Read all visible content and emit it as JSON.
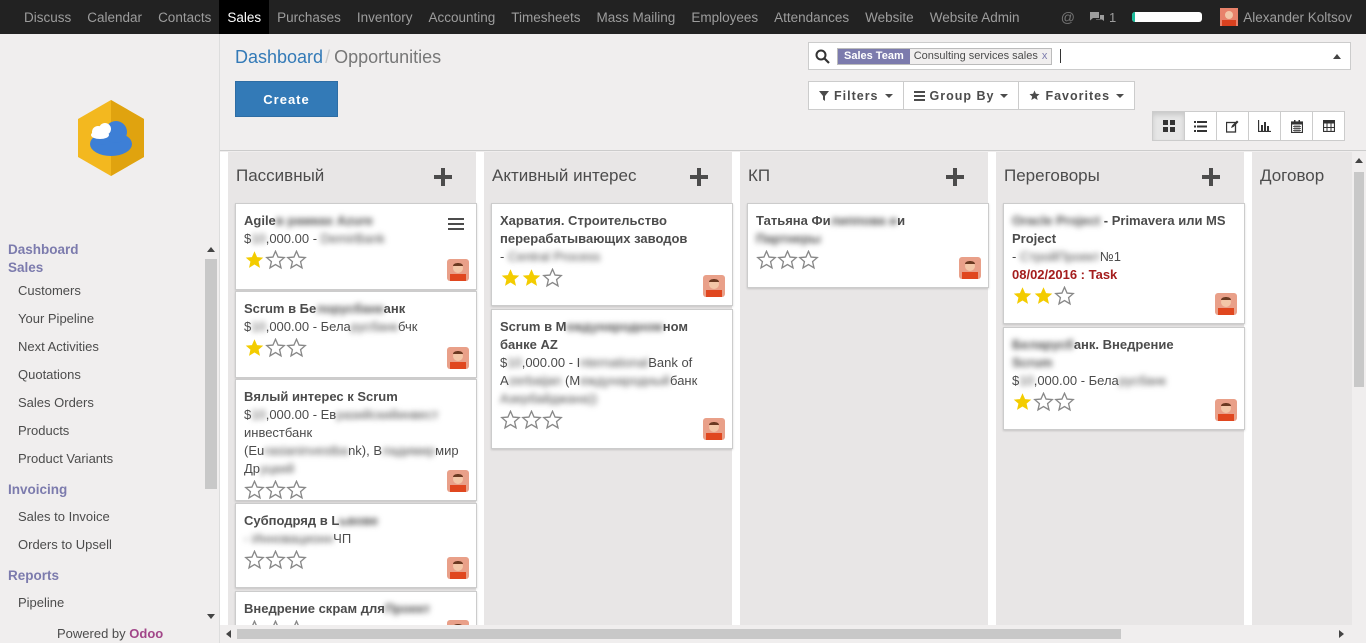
{
  "topmenu": [
    "Discuss",
    "Calendar",
    "Contacts",
    "Sales",
    "Purchases",
    "Inventory",
    "Accounting",
    "Timesheets",
    "Mass Mailing",
    "Employees",
    "Attendances",
    "Website",
    "Website Admin"
  ],
  "topmenu_active": "Sales",
  "topright": {
    "at": "@",
    "chat_count": "1",
    "user_name": "Alexander Koltsov"
  },
  "sidebar": {
    "sections": [
      {
        "title": "Dashboard",
        "items": []
      },
      {
        "title": "Sales",
        "items": [
          "Customers",
          "Your Pipeline",
          "Next Activities",
          "Quotations",
          "Sales Orders",
          "Products",
          "Product Variants"
        ]
      },
      {
        "title": "Invoicing",
        "items": [
          "Sales to Invoice",
          "Orders to Upsell"
        ]
      },
      {
        "title": "Reports",
        "items": [
          "Pipeline"
        ]
      }
    ],
    "powered_by": "Powered by",
    "powered_brand": "Odoo"
  },
  "breadcrumb": {
    "parent": "Dashboard",
    "separator": "/",
    "current": "Opportunities"
  },
  "create_label": "Create",
  "search": {
    "facet_label": "Sales Team",
    "facet_value": "Consulting services sales",
    "facet_remove": "x"
  },
  "filters": {
    "filters": "Filters",
    "group_by": "Group By",
    "favorites": "Favorites"
  },
  "views": [
    "kanban",
    "list",
    "form",
    "graph",
    "calendar",
    "pivot"
  ],
  "columns": [
    {
      "title": "Пассивный",
      "cards": [
        {
          "title": "Agile",
          "title_hidden": "в рамках Azure",
          "info": "$",
          "info_hidden": "10",
          "info2": ",000.00 - ",
          "info2_hidden": "DemirBank",
          "stars": 1,
          "menu": true
        },
        {
          "title": "Scrum в Бе",
          "title_hidden": "лорусбанк",
          "title2": "анк",
          "info": "$",
          "info_hidden": "10",
          "info2": ",000.00 - Бела",
          "info2_hidden": "русбанк",
          "info3": "бчк",
          "stars": 1
        },
        {
          "title": "Вялый интерес к Scrum",
          "info": "$",
          "info_hidden": "10",
          "info2": ",000.00 - Ев",
          "info2_hidden": "разийскийинвест",
          "info3": "инвестбанк",
          "line2": "(Eu",
          "line2_hidden": "rasianinvestba",
          "line2b": "nk), В",
          "line2b_hidden": "ладимир",
          "line2c": "мир",
          "line3": "Др",
          "line3_hidden": "уцкий",
          "stars": 0
        },
        {
          "title": "Субподряд в L",
          "title_hidden": "ьвове",
          "title2": "",
          "info": "",
          "info_hidden": "- Инновационн",
          "info2": "ЧП",
          "stars": 0
        },
        {
          "title": "Внедрение скрам для",
          "title_hidden": "Проект",
          "stars": 0
        }
      ]
    },
    {
      "title": "Активный интерес",
      "cards": [
        {
          "title": "Харватия. Строительство перерабатывающих заводов",
          "info": "- ",
          "info_hidden": "Central Process",
          "stars": 2
        },
        {
          "title": "Scrum в М",
          "title_hidden": "еждународном",
          "title2": "ном",
          "title_line2": "банке AZ",
          "info": "$",
          "info_hidden": "10",
          "info2": ",000.00 - I",
          "info2_hidden": "nternational",
          "info3": "Bank of",
          "line2": "A",
          "line2_hidden": "zerbaijan",
          "line2b": " (М",
          "line2b_hidden": "еждународный",
          "line2c": "банк",
          "line3": "",
          "line3_hidden": "Азербайджана))",
          "stars": 0
        }
      ]
    },
    {
      "title": "КП",
      "cards": [
        {
          "title": "Татьяна Фи",
          "title_hidden": "липпова и",
          "title2": "и",
          "title_line2_hidden": "Партнеры",
          "stars": 0
        }
      ]
    },
    {
      "title": "Переговоры",
      "cards": [
        {
          "title": "",
          "title_hidden": "Oracle Project",
          "title2": " - Primavera или MS Project",
          "info": "- ",
          "info_hidden": "СтройПроект",
          "info2": "№1",
          "task": "08/02/2016 : Task",
          "stars": 2
        },
        {
          "title": "",
          "title_hidden": "Беларусб",
          "title2": "анк. Внедрение",
          "title_line2_hidden": "Scrum",
          "info": "$",
          "info_hidden": "10",
          "info2": ",000.00 - Бела",
          "info2_hidden": "русбанк",
          "stars": 1
        }
      ]
    },
    {
      "title": "Договор",
      "cards": []
    }
  ],
  "colors": {
    "brand": "#7c7bad",
    "primary": "#337ab7",
    "star": "#f3cc00",
    "task": "#a41d1d"
  }
}
